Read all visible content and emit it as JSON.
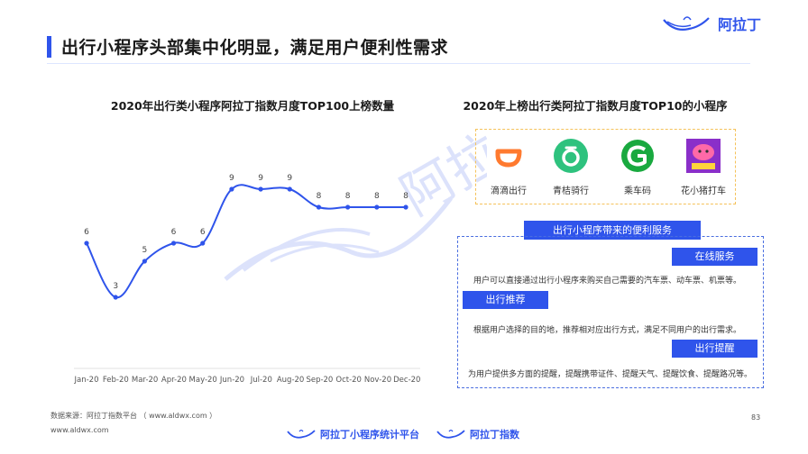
{
  "header": {
    "title": "出行小程序头部集中化明显，满足用户便利性需求",
    "logo_text": "阿拉丁"
  },
  "left_chart_title": "2020年出行类小程序阿拉丁指数月度TOP100上榜数量",
  "chart_data": {
    "type": "line",
    "title": "2020年出行类小程序阿拉丁指数月度TOP100上榜数量",
    "categories": [
      "Jan-20",
      "Feb-20",
      "Mar-20",
      "Apr-20",
      "May-20",
      "Jun-20",
      "Jul-20",
      "Aug-20",
      "Sep-20",
      "Oct-20",
      "Nov-20",
      "Dec-20"
    ],
    "series": [
      {
        "values": [
          6,
          3,
          5,
          6,
          6,
          9,
          9,
          9,
          8,
          8,
          8,
          8
        ]
      }
    ],
    "ylim": [
      0,
      11
    ],
    "color": "#2f54eb",
    "grid": false,
    "data_labels": true
  },
  "right_title": "2020年上榜出行类阿拉丁指数月度TOP10的小程序",
  "apps": [
    {
      "name": "滴滴出行",
      "icon": "didi-icon",
      "color": "#ff7a2f"
    },
    {
      "name": "青桔骑行",
      "icon": "qingju-icon",
      "color": "#2ec27e"
    },
    {
      "name": "乘车码",
      "icon": "ride-code-icon",
      "color": "#19a93f"
    },
    {
      "name": "花小猪打车",
      "icon": "huaxiaozhu-icon",
      "color": "#e8358a"
    }
  ],
  "services": {
    "header": "出行小程序带来的便利服务",
    "items": [
      {
        "tag": "在线服务",
        "text": "用户可以直接通过出行小程序来购买自己需要的汽车票、动车票、机票等。"
      },
      {
        "tag": "出行推荐",
        "text": "根据用户选择的目的地，推荐相对应出行方式，满足不同用户的出行需求。"
      },
      {
        "tag": "出行提醒",
        "text": "为用户提供多方面的提醒，提醒携带证件、提醒天气、提醒饮食、提醒路况等。"
      }
    ]
  },
  "footer": {
    "source": "数据来源：阿拉丁指数平台 （ www.aldwx.com ）",
    "site": "www.aldwx.com",
    "page": "83",
    "brand_left": "阿拉丁小程序统计平台",
    "brand_right": "阿拉丁指数"
  },
  "watermark_text": "阿拉丁"
}
